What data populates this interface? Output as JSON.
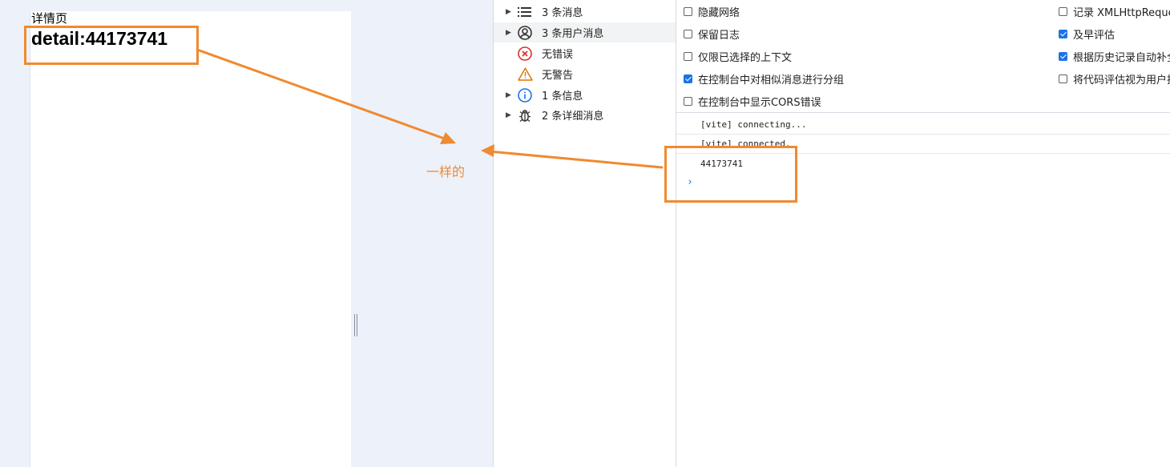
{
  "page": {
    "heading": "详情页",
    "detail": "detail:44173741"
  },
  "annotation": {
    "label": "一样的",
    "color": "#f08a30"
  },
  "devtools": {
    "sidebar": {
      "items": [
        {
          "label": "3 条消息",
          "icon": "list-icon",
          "expandable": true
        },
        {
          "label": "3 条用户消息",
          "icon": "user-icon",
          "expandable": true,
          "selected": true
        },
        {
          "label": "无错误",
          "icon": "error-icon",
          "expandable": false
        },
        {
          "label": "无警告",
          "icon": "warning-icon",
          "expandable": false
        },
        {
          "label": "1 条信息",
          "icon": "info-icon",
          "expandable": true
        },
        {
          "label": "2 条详细消息",
          "icon": "bug-icon",
          "expandable": true
        }
      ]
    },
    "settings": {
      "left": [
        {
          "label": "隐藏网络",
          "checked": false
        },
        {
          "label": "保留日志",
          "checked": false
        },
        {
          "label": "仅限已选择的上下文",
          "checked": false
        },
        {
          "label": "在控制台中对相似消息进行分组",
          "checked": true
        },
        {
          "label": "在控制台中显示CORS错误",
          "checked": false
        }
      ],
      "right": [
        {
          "label": "记录 XMLHttpReque",
          "checked": false
        },
        {
          "label": "及早评估",
          "checked": true
        },
        {
          "label": "根据历史记录自动补全",
          "checked": true
        },
        {
          "label": "将代码评估视为用户指",
          "checked": false
        }
      ]
    },
    "console": {
      "lines": [
        "[vite] connecting...",
        "[vite] connected.",
        "44173741"
      ],
      "prompt": "›"
    }
  }
}
